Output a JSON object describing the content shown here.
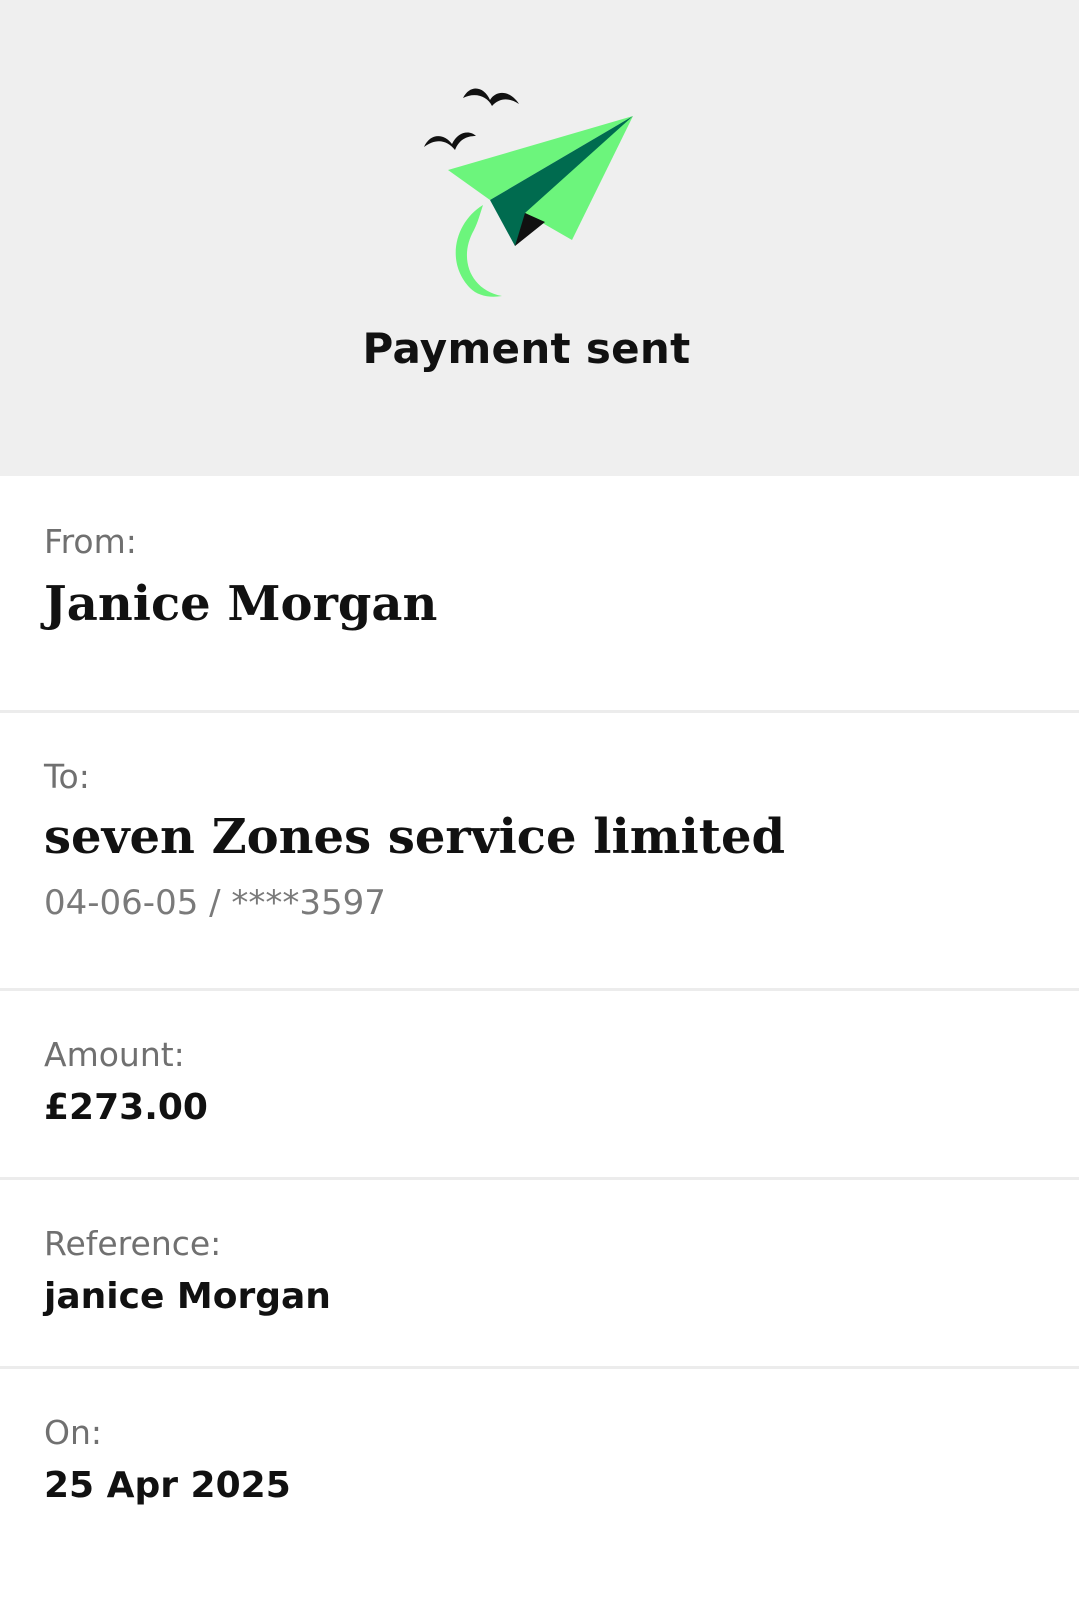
{
  "header": {
    "title": "Payment sent",
    "illustration_icon": "paper-plane-with-birds-icon",
    "colors": {
      "light_green": "#6cf57c",
      "dark_green": "#006b4f",
      "background": "#efefef"
    }
  },
  "details": {
    "from": {
      "label": "From:",
      "value": "Janice Morgan"
    },
    "to": {
      "label": "To:",
      "value": "seven Zones service limited",
      "account": "04-06-05 / ****3597"
    },
    "amount": {
      "label": "Amount:",
      "value": "£273.00"
    },
    "reference": {
      "label": "Reference:",
      "value": "janice Morgan"
    },
    "date": {
      "label": "On:",
      "value": "25 Apr 2025"
    }
  }
}
